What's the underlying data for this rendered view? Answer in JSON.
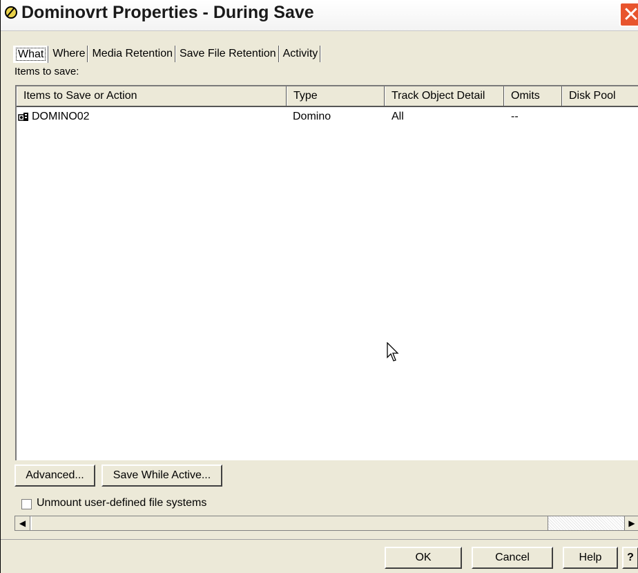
{
  "window": {
    "title": "Dominovrt Properties - During Save",
    "close_glyph": "✕"
  },
  "tabs": [
    {
      "label": "What",
      "active": true
    },
    {
      "label": "Where",
      "active": false
    },
    {
      "label": "Media Retention",
      "active": false
    },
    {
      "label": "Save File Retention",
      "active": false
    },
    {
      "label": "Activity",
      "active": false
    }
  ],
  "items_label": "Items to save:",
  "table": {
    "columns": [
      "Items to Save or Action",
      "Type",
      "Track Object Detail",
      "Omits",
      "Disk Pool"
    ],
    "rows": [
      {
        "name": "DOMINO02",
        "type": "Domino",
        "track": "All",
        "omits": "--",
        "disk_pool": "",
        "icon": "domino-server-icon"
      }
    ]
  },
  "buttons": {
    "advanced": "Advanced...",
    "save_while_active": "Save While Active...",
    "ok": "OK",
    "cancel": "Cancel",
    "help": "Help",
    "context_help": "?"
  },
  "checkbox": {
    "label": "Unmount user-defined file systems",
    "checked": false
  },
  "scroll": {
    "left_arrow": "◀",
    "right_arrow": "▶"
  },
  "colors": {
    "title_bar": "#ffffff",
    "close_button": "#e8542d",
    "dialog_bg": "#ece9d8"
  }
}
